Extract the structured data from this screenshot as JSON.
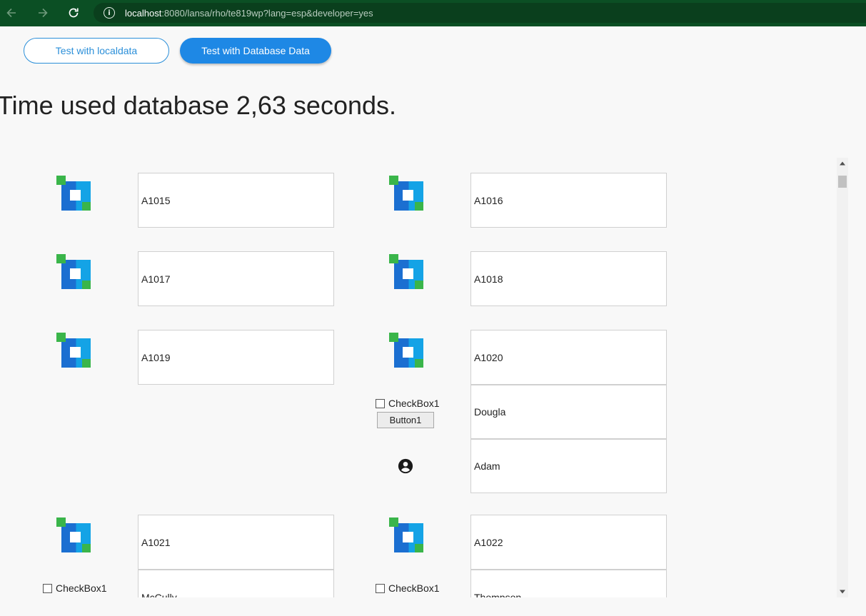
{
  "browser": {
    "url_host": "localhost",
    "url_rest": ":8080/lansa/rho/te819wp?lang=esp&developer=yes"
  },
  "toolbar": {
    "local_label": "Test with localdata",
    "database_label": "Test with Database Data"
  },
  "time_heading": "Time used database 2,63 seconds.",
  "colors": {
    "chrome": "#0b4f24",
    "accent": "#1e88e5",
    "logo_green": "#3ab54a",
    "logo_blue_dark": "#1b6fd1",
    "logo_blue_light": "#14a3e6"
  },
  "icons": [
    "back-arrow-icon",
    "forward-arrow-icon",
    "reload-icon",
    "info-icon",
    "lansa-logo-icon",
    "account-circle-icon"
  ],
  "items": [
    {
      "code": "A1015"
    },
    {
      "code": "A1016"
    },
    {
      "code": "A1017"
    },
    {
      "code": "A1018"
    },
    {
      "code": "A1019"
    },
    {
      "code": "A1020",
      "first_name": "Dougla",
      "last_name": "Adam",
      "checkbox_label": "CheckBox1",
      "button_label": "Button1"
    },
    {
      "code": "A1021",
      "last_name": "McCully",
      "checkbox_label": "CheckBox1"
    },
    {
      "code": "A1022",
      "last_name": "Thompson",
      "checkbox_label": "CheckBox1"
    }
  ]
}
